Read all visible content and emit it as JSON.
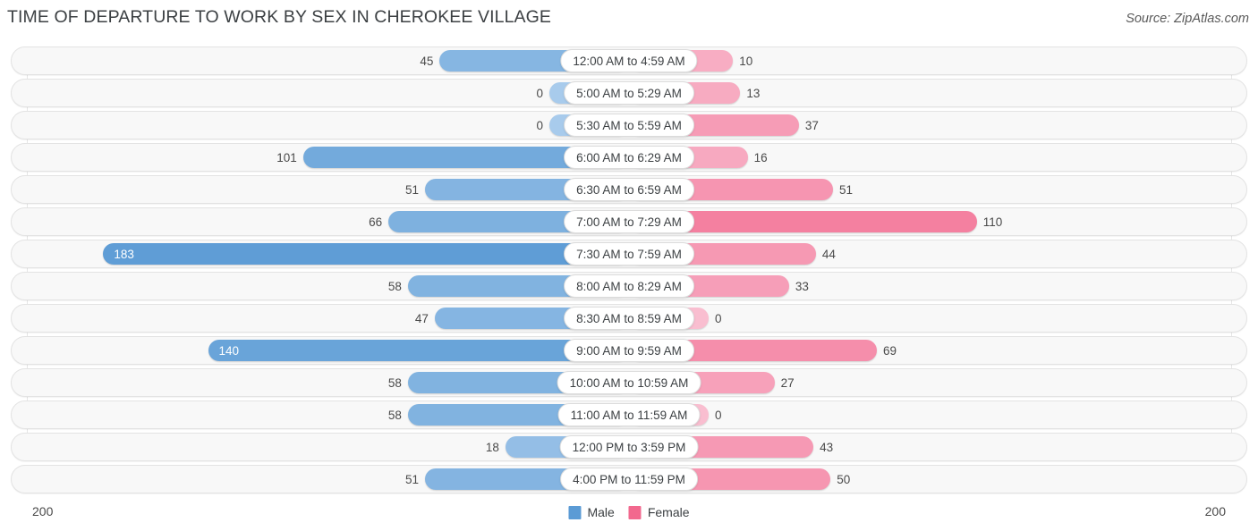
{
  "header": {
    "title": "TIME OF DEPARTURE TO WORK BY SEX IN CHEROKEE VILLAGE",
    "source": "Source: ZipAtlas.com"
  },
  "legend": {
    "items": [
      {
        "label": "Male",
        "color": "#5b9bd5"
      },
      {
        "label": "Female",
        "color": "#f2688e"
      }
    ]
  },
  "axis": {
    "left_label": "200",
    "right_label": "200"
  },
  "colors": {
    "male_base": "#5b9bd5",
    "male_light": "#a8cbec",
    "female_base": "#f2688e",
    "female_light": "#f9bed0",
    "row_background": "#f8f8f8",
    "row_border": "#e3e3e3",
    "gridline": "#e6e6e6",
    "text": "#3c4043"
  },
  "chart_data": {
    "type": "bar",
    "title": "TIME OF DEPARTURE TO WORK BY SEX IN CHEROKEE VILLAGE",
    "subtitle": "",
    "orientation": "horizontal-diverging",
    "xlabel": "",
    "ylabel": "",
    "xlim": [
      -200,
      200
    ],
    "axis_max": 200,
    "grid": false,
    "legend_position": "bottom-center",
    "categories": [
      "12:00 AM to 4:59 AM",
      "5:00 AM to 5:29 AM",
      "5:30 AM to 5:59 AM",
      "6:00 AM to 6:29 AM",
      "6:30 AM to 6:59 AM",
      "7:00 AM to 7:29 AM",
      "7:30 AM to 7:59 AM",
      "8:00 AM to 8:29 AM",
      "8:30 AM to 8:59 AM",
      "9:00 AM to 9:59 AM",
      "10:00 AM to 10:59 AM",
      "11:00 AM to 11:59 AM",
      "12:00 PM to 3:59 PM",
      "4:00 PM to 11:59 PM"
    ],
    "series": [
      {
        "name": "Male",
        "color": "#5b9bd5",
        "values": [
          45,
          0,
          0,
          101,
          51,
          66,
          183,
          58,
          47,
          140,
          58,
          58,
          18,
          51
        ]
      },
      {
        "name": "Female",
        "color": "#f2688e",
        "values": [
          10,
          13,
          37,
          16,
          51,
          110,
          44,
          33,
          0,
          69,
          27,
          0,
          43,
          50
        ]
      }
    ]
  },
  "rows": [
    {
      "category": "12:00 AM to 4:59 AM",
      "male": "45",
      "female": "10",
      "male_value": 45,
      "female_value": 10
    },
    {
      "category": "5:00 AM to 5:29 AM",
      "male": "0",
      "female": "13",
      "male_value": 0,
      "female_value": 13
    },
    {
      "category": "5:30 AM to 5:59 AM",
      "male": "0",
      "female": "37",
      "male_value": 0,
      "female_value": 37
    },
    {
      "category": "6:00 AM to 6:29 AM",
      "male": "101",
      "female": "16",
      "male_value": 101,
      "female_value": 16
    },
    {
      "category": "6:30 AM to 6:59 AM",
      "male": "51",
      "female": "51",
      "male_value": 51,
      "female_value": 51
    },
    {
      "category": "7:00 AM to 7:29 AM",
      "male": "66",
      "female": "110",
      "male_value": 66,
      "female_value": 110
    },
    {
      "category": "7:30 AM to 7:59 AM",
      "male": "183",
      "female": "44",
      "male_value": 183,
      "female_value": 44
    },
    {
      "category": "8:00 AM to 8:29 AM",
      "male": "58",
      "female": "33",
      "male_value": 58,
      "female_value": 33
    },
    {
      "category": "8:30 AM to 8:59 AM",
      "male": "47",
      "female": "0",
      "male_value": 47,
      "female_value": 0
    },
    {
      "category": "9:00 AM to 9:59 AM",
      "male": "140",
      "female": "69",
      "male_value": 140,
      "female_value": 69
    },
    {
      "category": "10:00 AM to 10:59 AM",
      "male": "58",
      "female": "27",
      "male_value": 58,
      "female_value": 27
    },
    {
      "category": "11:00 AM to 11:59 AM",
      "male": "58",
      "female": "0",
      "male_value": 58,
      "female_value": 0
    },
    {
      "category": "12:00 PM to 3:59 PM",
      "male": "18",
      "female": "43",
      "male_value": 18,
      "female_value": 43
    },
    {
      "category": "4:00 PM to 11:59 PM",
      "male": "51",
      "female": "50",
      "male_value": 51,
      "female_value": 50
    }
  ]
}
